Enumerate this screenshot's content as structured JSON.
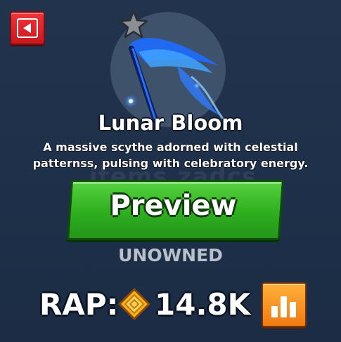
{
  "item": {
    "name": "Lunar Bloom",
    "description": "A massive scythe adorned with celestial patternss, pulsing with celebratory energy.",
    "status": "UNOWNED"
  },
  "actions": {
    "preview_label": "Preview"
  },
  "rap": {
    "label": "RAP:",
    "value": "14.8K"
  },
  "watermark": "items.zadcs",
  "icons": {
    "back": "back-arrow-icon",
    "star": "star-icon",
    "currency": "diamond-coin-icon",
    "chart": "bar-chart-icon"
  },
  "colors": {
    "background": "#1f3149",
    "back_button": "#d8232a",
    "preview_button": "#3cbf2a",
    "chart_button": "#f59a22",
    "coin": "#f6b21a",
    "status_text": "#b9c0c9"
  }
}
